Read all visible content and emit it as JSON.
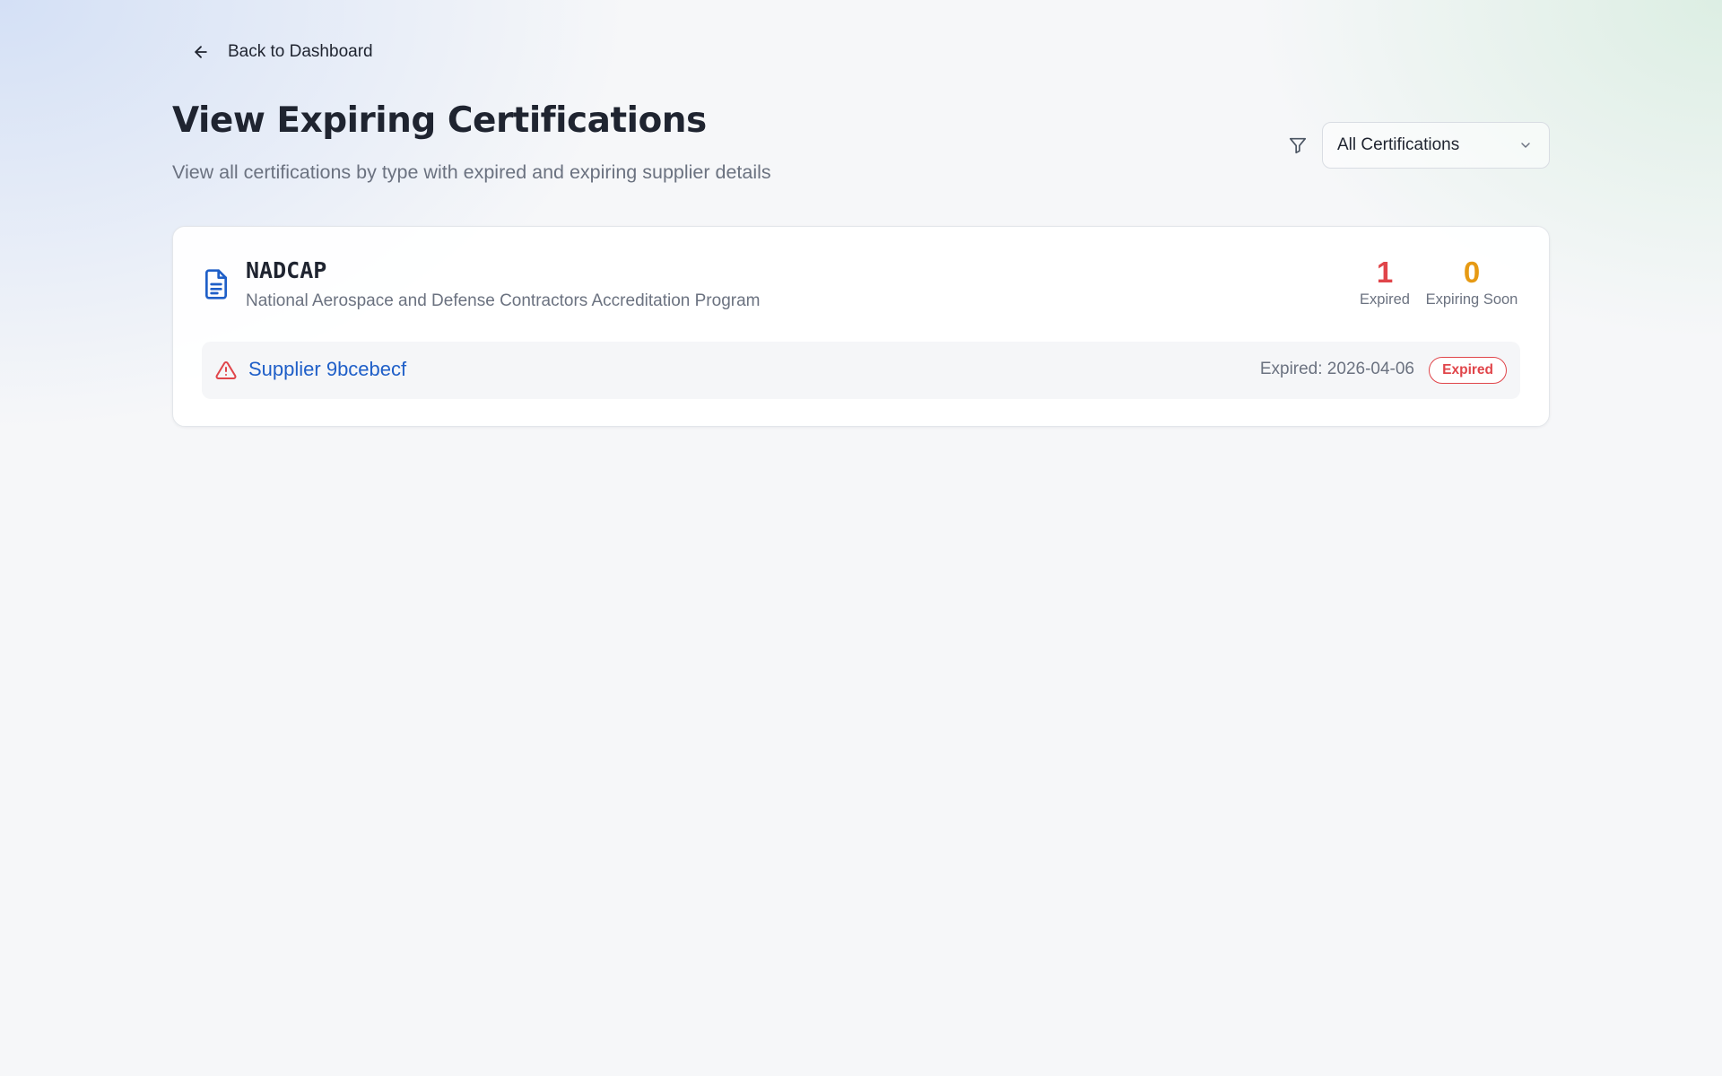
{
  "nav": {
    "back_label": "Back to Dashboard",
    "back_icon": "arrow-left-icon"
  },
  "header": {
    "title": "View Expiring Certifications",
    "subtitle": "View all certifications by type with expired and expiring supplier details"
  },
  "filter": {
    "icon": "filter-icon",
    "selected": "All Certifications"
  },
  "certifications": [
    {
      "icon": "document-icon",
      "name": "NADCAP",
      "full_name": "National Aerospace and Defense Contractors Accreditation Program",
      "stats": {
        "expired_count": "1",
        "expired_label": "Expired",
        "expiring_count": "0",
        "expiring_label": "Expiring Soon"
      },
      "suppliers": [
        {
          "icon": "warning-icon",
          "name": "Supplier 9bcebecf",
          "expiry_text": "Expired: 2026-04-06",
          "status": "Expired"
        }
      ]
    }
  ],
  "colors": {
    "expired": "#e0454a",
    "expiring": "#e69a14",
    "link": "#1f5fc8",
    "icon_blue": "#1f5fc8"
  }
}
